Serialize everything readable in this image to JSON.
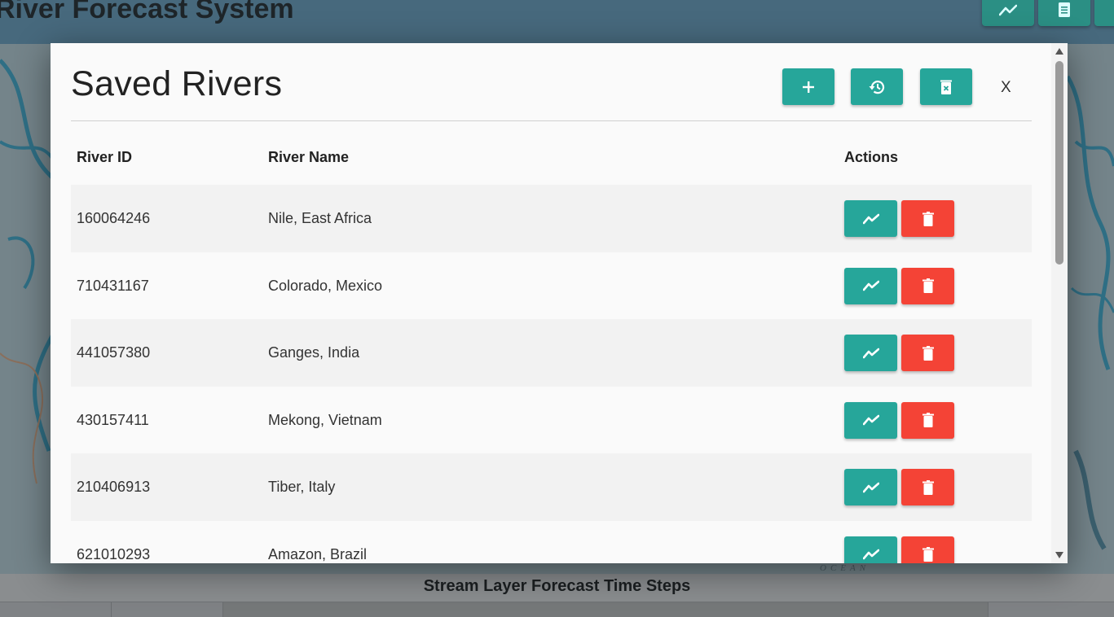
{
  "app": {
    "title": "River Forecast System",
    "header_buttons": [
      {
        "icon": "chart-line-icon"
      },
      {
        "icon": "document-icon"
      }
    ]
  },
  "map": {
    "ocean_label": "OCEAN"
  },
  "timesteps": {
    "title": "Stream Layer Forecast Time Steps"
  },
  "modal": {
    "title": "Saved Rivers",
    "toolbar": [
      {
        "name": "add-river-button",
        "icon": "plus-icon"
      },
      {
        "name": "history-button",
        "icon": "history-icon"
      },
      {
        "name": "clear-all-button",
        "icon": "delete-file-icon"
      }
    ],
    "close_label": "X",
    "columns": [
      "River ID",
      "River Name",
      "Actions"
    ],
    "rows": [
      {
        "id": "160064246",
        "name": "Nile, East Africa"
      },
      {
        "id": "710431167",
        "name": "Colorado, Mexico"
      },
      {
        "id": "441057380",
        "name": "Ganges, India"
      },
      {
        "id": "430157411",
        "name": "Mekong, Vietnam"
      },
      {
        "id": "210406913",
        "name": "Tiber, Italy"
      },
      {
        "id": "621010293",
        "name": "Amazon, Brazil"
      }
    ]
  },
  "colors": {
    "accent_teal": "#26a69a",
    "danger_red": "#f44336",
    "header_bg": "#47697d"
  }
}
